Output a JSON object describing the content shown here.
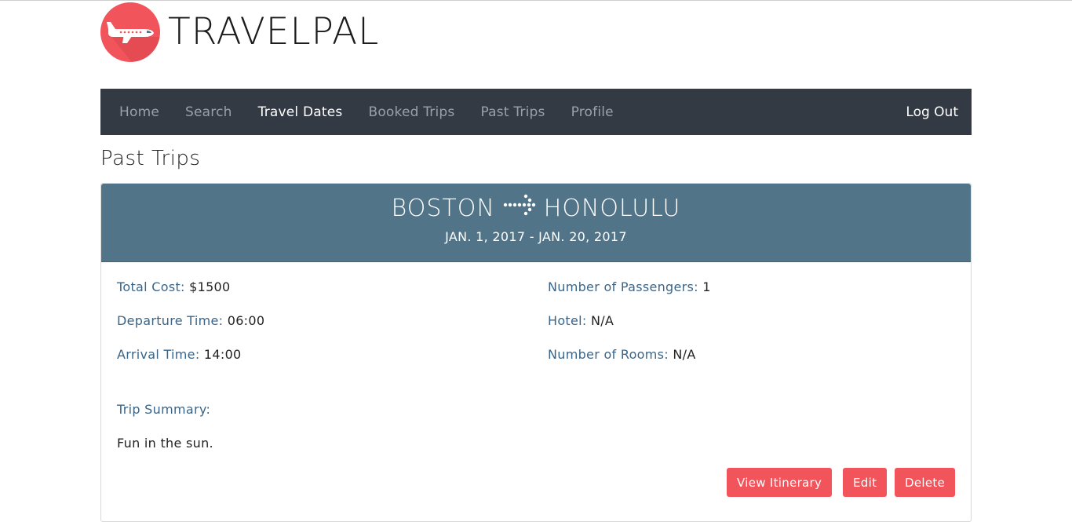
{
  "brand": {
    "name": "TRAVELPAL",
    "logo_icon": "airplane-icon",
    "logo_color": "#f2545b"
  },
  "nav": {
    "items": [
      {
        "label": "Home",
        "active": false
      },
      {
        "label": "Search",
        "active": false
      },
      {
        "label": "Travel Dates",
        "active": true
      },
      {
        "label": "Booked Trips",
        "active": false
      },
      {
        "label": "Past Trips",
        "active": false
      },
      {
        "label": "Profile",
        "active": false
      }
    ],
    "logout_label": "Log Out",
    "background": "#343a44"
  },
  "page": {
    "title": "Past Trips"
  },
  "trip": {
    "origin": "BOSTON",
    "destination": "HONOLULU",
    "dates": "JAN. 1, 2017 - JAN. 20, 2017",
    "header_color": "#527489",
    "fields": {
      "total_cost": {
        "label": "Total Cost:",
        "value": "$1500"
      },
      "departure_time": {
        "label": "Departure Time:",
        "value": "06:00"
      },
      "arrival_time": {
        "label": "Arrival Time:",
        "value": "14:00"
      },
      "passengers": {
        "label": "Number of Passengers:",
        "value": "1"
      },
      "hotel": {
        "label": "Hotel:",
        "value": "N/A"
      },
      "rooms": {
        "label": "Number of Rooms:",
        "value": "N/A"
      }
    },
    "summary_label": "Trip Summary:",
    "summary_text": "Fun in the sun.",
    "buttons": {
      "view_itinerary": "View Itinerary",
      "edit": "Edit",
      "delete": "Delete"
    },
    "button_color": "#f2545b"
  }
}
